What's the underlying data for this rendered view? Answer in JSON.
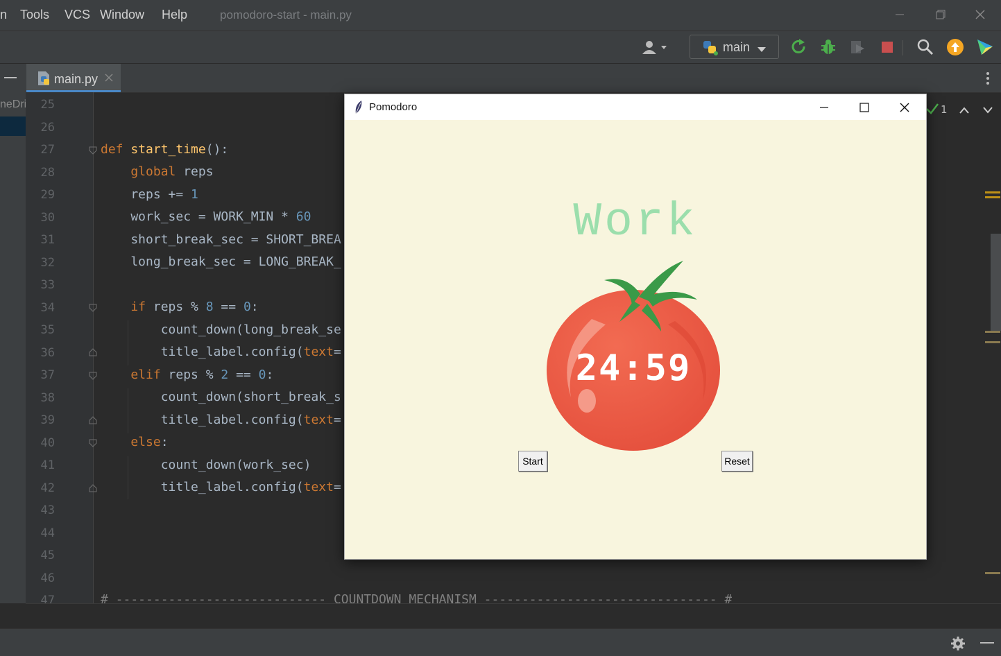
{
  "menu": {
    "partial_left": "n",
    "items": [
      "Tools",
      "VCS",
      "Window",
      "Help"
    ],
    "window_title": "pomodoro-start - main.py"
  },
  "toolbar": {
    "run_config": "main",
    "icons": [
      "user-icon",
      "rerun-icon",
      "debug-icon",
      "coverage-icon",
      "stop-icon",
      "search-icon",
      "update-icon",
      "plugin-icon"
    ],
    "colors": {
      "rerun": "#4cae4c",
      "debug": "#4cae4c",
      "stop": "#c94f4f",
      "update": "#f5a623"
    }
  },
  "editor": {
    "tab_label": "main.py",
    "left_strip_text": "neDri",
    "inspection_count": "1",
    "lines": [
      {
        "n": "25",
        "code": ""
      },
      {
        "n": "26",
        "code": ""
      },
      {
        "n": "27",
        "code": "def start_time():"
      },
      {
        "n": "28",
        "code": "    global reps"
      },
      {
        "n": "29",
        "code": "    reps += 1"
      },
      {
        "n": "30",
        "code": "    work_sec = WORK_MIN * 60"
      },
      {
        "n": "31",
        "code": "    short_break_sec = SHORT_BREA"
      },
      {
        "n": "32",
        "code": "    long_break_sec = LONG_BREAK_"
      },
      {
        "n": "33",
        "code": ""
      },
      {
        "n": "34",
        "code": "    if reps % 8 == 0:"
      },
      {
        "n": "35",
        "code": "        count_down(long_break_se"
      },
      {
        "n": "36",
        "code": "        title_label.config(text="
      },
      {
        "n": "37",
        "code": "    elif reps % 2 == 0:"
      },
      {
        "n": "38",
        "code": "        count_down(short_break_s"
      },
      {
        "n": "39",
        "code": "        title_label.config(text="
      },
      {
        "n": "40",
        "code": "    else:"
      },
      {
        "n": "41",
        "code": "        count_down(work_sec)"
      },
      {
        "n": "42",
        "code": "        title_label.config(text="
      },
      {
        "n": "43",
        "code": ""
      },
      {
        "n": "44",
        "code": ""
      },
      {
        "n": "45",
        "code": ""
      },
      {
        "n": "46",
        "code": ""
      },
      {
        "n": "47",
        "code": "# ---------------------------- COUNTDOWN MECHANISM ------------------------------- #"
      }
    ]
  },
  "pomodoro": {
    "window_title": "Pomodoro",
    "title_label": "Work",
    "timer_text": "24:59",
    "start_button": "Start",
    "reset_button": "Reset",
    "colors": {
      "background": "#f8f5de",
      "label": "#9bdeac",
      "tomato": "#ee5a43",
      "leaf": "#3a9a48"
    }
  }
}
